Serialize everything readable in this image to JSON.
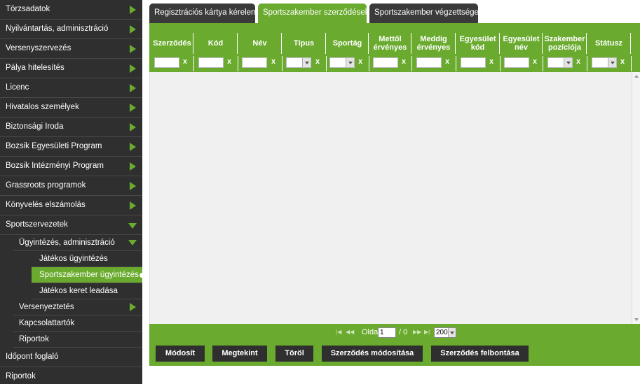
{
  "sidebar": {
    "items": [
      {
        "label": "Törzsadatok"
      },
      {
        "label": "Nyilvántartás, adminisztráció"
      },
      {
        "label": "Versenyszervezés"
      },
      {
        "label": "Pálya hitelesítés"
      },
      {
        "label": "Licenc"
      },
      {
        "label": "Hivatalos személyek"
      },
      {
        "label": "Biztonsági Iroda"
      },
      {
        "label": "Bozsik Egyesületi Program"
      },
      {
        "label": "Bozsik Intézményi Program"
      },
      {
        "label": "Grassroots programok"
      },
      {
        "label": "Könyvelés elszámolás"
      },
      {
        "label": "Sportszervezetek"
      }
    ],
    "sportszervezetek_sub": {
      "ugyintezes": "Ügyintézés, adminisztráció",
      "ugyintezes_items": [
        "Játékos ügyintézés",
        "Sportszakember ügyintézés",
        "Játékos keret leadása"
      ],
      "versenyeztetes": "Versenyeztetés",
      "kapcsolattartok": "Kapcsolattartók",
      "riportok": "Riportok"
    },
    "idopont": "Időpont foglaló",
    "riportok": "Riportok"
  },
  "tabs": [
    {
      "label": "Regisztrációs kártya kérelem"
    },
    {
      "label": "Sportszakember szerződések"
    },
    {
      "label": "Sportszakember végzettségek"
    }
  ],
  "grid": {
    "columns": [
      {
        "line1": "Szerződés",
        "line2": ""
      },
      {
        "line1": "Kód",
        "line2": ""
      },
      {
        "line1": "Név",
        "line2": ""
      },
      {
        "line1": "Típus",
        "line2": ""
      },
      {
        "line1": "Sportág",
        "line2": ""
      },
      {
        "line1": "Mettől",
        "line2": "érvényes"
      },
      {
        "line1": "Meddig",
        "line2": "érvényes"
      },
      {
        "line1": "Egyesület",
        "line2": "kód"
      },
      {
        "line1": "Egyesület",
        "line2": "név"
      },
      {
        "line1": "Szakember",
        "line2": "pozíciója"
      },
      {
        "line1": "Státusz",
        "line2": ""
      }
    ],
    "clear_label": "x"
  },
  "pager": {
    "label": "Oldal",
    "page": "1",
    "total": "/ 0",
    "page_size": "200"
  },
  "buttons": {
    "modify": "Módosít",
    "view": "Megtekint",
    "delete": "Töröl",
    "contract_modify": "Szerződés módosítása",
    "contract_terminate": "Szerződés felbontása"
  },
  "colors": {
    "accent": "#6aab2f",
    "dark": "#2f2f2f"
  }
}
